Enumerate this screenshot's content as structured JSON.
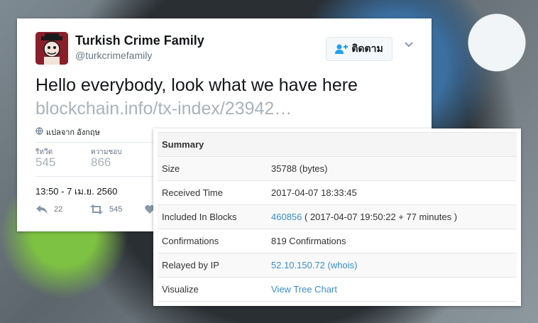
{
  "tweet": {
    "display_name": "Turkish Crime Family",
    "handle": "@turkcrimefamily",
    "follow_label": "ติดตาม",
    "text": "Hello everybody, look what we have here",
    "link": "blockchain.info/tx-index/23942…",
    "translate_label": "แปลจาก อังกฤษ",
    "stats": [
      {
        "label": "รีทวีต",
        "value": "545"
      },
      {
        "label": "ความชอบ",
        "value": "866"
      }
    ],
    "timestamp": "13:50 - 7 เม.ย. 2560",
    "actions": {
      "reply_count": "22",
      "retweet_count": "545"
    },
    "colors": {
      "accent": "#1da1f2",
      "link": "#a8b3bb"
    }
  },
  "summary": {
    "title": "Summary",
    "rows": [
      {
        "key": "Size",
        "value": "35788 (bytes)"
      },
      {
        "key": "Received Time",
        "value": "2017-04-07 18:33:45"
      },
      {
        "key": "Included In Blocks",
        "value_link": "460856",
        "value": "( 2017-04-07 19:50:22 + 77 minutes )"
      },
      {
        "key": "Confirmations",
        "value": "819 Confirmations"
      },
      {
        "key": "Relayed by IP",
        "value_link": "52.10.150.72 (whois)"
      },
      {
        "key": "Visualize",
        "value_link": "View Tree Chart"
      }
    ],
    "colors": {
      "link": "#3a8fc9",
      "header_bg": "#f5f5f5"
    }
  }
}
